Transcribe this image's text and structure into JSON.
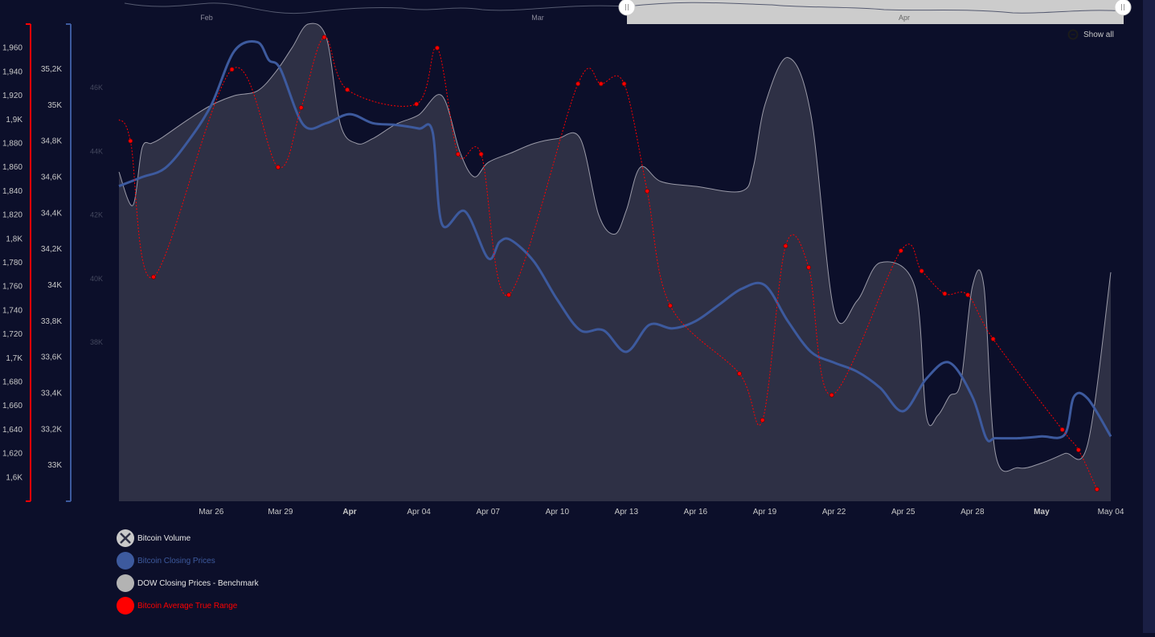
{
  "colors": {
    "background": "#0c0f2a",
    "volume": "#2e3045",
    "volume_line": "#9a9aa8",
    "btc": "#3d5a9e",
    "dow": "#b3b3b3",
    "atr": "#ff0000",
    "axis_text": "#c8c8c8",
    "navigator_fill": "#cccccc"
  },
  "navigator": {
    "labels": [
      "Feb",
      "Mar",
      "Apr"
    ]
  },
  "show_all": {
    "label": "Show all",
    "icon": "zoom-out-icon"
  },
  "chart_data": {
    "type": "line",
    "title": "",
    "x_labels": [
      "Mar 26",
      "Mar 29",
      "Apr",
      "Apr 04",
      "Apr 07",
      "Apr 10",
      "Apr 13",
      "Apr 16",
      "Apr 19",
      "Apr 22",
      "Apr 25",
      "Apr 28",
      "May",
      "May 04"
    ],
    "x_labels_bold": [
      "Apr",
      "May"
    ],
    "xlim": [
      "Mar 22",
      "May 04"
    ],
    "axes": [
      {
        "id": "atr",
        "color": "#ff0000",
        "ylim": [
          1580,
          1980
        ],
        "ticks": [
          "1,6K",
          "1,620",
          "1,640",
          "1,660",
          "1,680",
          "1,7K",
          "1,720",
          "1,740",
          "1,760",
          "1,780",
          "1,8K",
          "1,820",
          "1,840",
          "1,860",
          "1,880",
          "1,9K",
          "1,920",
          "1,940",
          "1,960"
        ],
        "tick_values": [
          1600,
          1620,
          1640,
          1660,
          1680,
          1700,
          1720,
          1740,
          1760,
          1780,
          1800,
          1820,
          1840,
          1860,
          1880,
          1900,
          1920,
          1940,
          1960
        ]
      },
      {
        "id": "btc",
        "color": "#3d5a9e",
        "ylim": [
          32800,
          35450
        ],
        "ticks": [
          "33K",
          "33,2K",
          "33,4K",
          "33,6K",
          "33,8K",
          "34K",
          "34,2K",
          "34,4K",
          "34,6K",
          "34,8K",
          "35K",
          "35,2K"
        ],
        "tick_values": [
          33000,
          33200,
          33400,
          33600,
          33800,
          34000,
          34200,
          34400,
          34600,
          34800,
          35000,
          35200
        ]
      },
      {
        "id": "dow",
        "color": "#44485e",
        "ylim": [
          33000,
          48000
        ],
        "ticks": [
          "38K",
          "40K",
          "42K",
          "44K",
          "46K"
        ],
        "tick_values": [
          38000,
          40000,
          42000,
          44000,
          46000
        ]
      },
      {
        "id": "volume",
        "ylim": [
          0,
          100
        ]
      }
    ],
    "series": [
      {
        "name": "Bitcoin Volume",
        "type": "area",
        "axis": "volume",
        "x": [
          "Mar 22",
          "Mar 22.6",
          "Mar 23",
          "Mar 23.4",
          "Mar 23.8",
          "Mar 25",
          "Mar 26",
          "Mar 27",
          "Mar 28",
          "Mar 28.8",
          "Mar 29.5",
          "Mar 30.2",
          "Mar 31",
          "Mar 31.6",
          "Apr 01.3",
          "Apr 02",
          "Apr 03",
          "Apr 04",
          "Apr 05",
          "Apr 05.8",
          "Apr 06.4",
          "Apr 07",
          "Apr 08",
          "Apr 09",
          "Apr 10",
          "Apr 11",
          "Apr 11.8",
          "Apr 12.5",
          "Apr 13",
          "Apr 13.6",
          "Apr 14.5",
          "Apr 16",
          "Apr 18",
          "Apr 18.5",
          "Apr 19",
          "Apr 20",
          "Apr 21",
          "Apr 22",
          "Apr 23",
          "Apr 24",
          "Apr 25.5",
          "Apr 26",
          "Apr 26.5",
          "Apr 27",
          "Apr 27.5",
          "Apr 28",
          "Apr 28.5",
          "Apr 29",
          "Apr 30",
          "May 01",
          "May 02",
          "May 03",
          "May 04"
        ],
        "y": [
          69,
          62,
          74,
          75,
          76,
          80,
          83,
          85,
          86,
          90,
          95,
          100,
          97,
          79,
          75,
          76,
          79,
          81,
          85,
          73,
          68,
          71,
          73,
          75,
          76,
          76,
          60,
          56,
          61,
          70,
          67,
          66,
          65,
          70,
          83,
          93,
          81,
          40,
          42,
          50,
          45,
          18,
          18,
          22,
          25,
          45,
          45,
          10,
          7,
          8,
          10,
          12,
          48
        ]
      },
      {
        "name": "Bitcoin Closing Prices",
        "type": "spline",
        "axis": "btc",
        "x": [
          "Mar 22",
          "Mar 23",
          "Mar 24",
          "Mar 25",
          "Mar 26",
          "Mar 27",
          "Mar 28",
          "Mar 28.5",
          "Mar 29",
          "Mar 30",
          "Mar 31",
          "Apr 01",
          "Apr 02",
          "Apr 03",
          "Apr 04",
          "Apr 04.6",
          "Apr 05",
          "Apr 06",
          "Apr 07",
          "Apr 07.5",
          "Apr 08",
          "Apr 09",
          "Apr 10",
          "Apr 11",
          "Apr 12",
          "Apr 13",
          "Apr 14",
          "Apr 15",
          "Apr 16",
          "Apr 17",
          "Apr 18",
          "Apr 19",
          "Apr 20",
          "Apr 21",
          "Apr 22",
          "Apr 23",
          "Apr 24",
          "Apr 25",
          "Apr 26",
          "Apr 27",
          "Apr 28",
          "Apr 28.6",
          "Apr 29",
          "Apr 30",
          "May 01",
          "May 02",
          "May 02.4",
          "May 03",
          "May 04"
        ],
        "y": [
          34550,
          34600,
          34650,
          34800,
          35000,
          35300,
          35350,
          35250,
          35200,
          34890,
          34900,
          34950,
          34900,
          34890,
          34870,
          34850,
          34340,
          34410,
          34150,
          34240,
          34250,
          34130,
          33920,
          33750,
          33750,
          33630,
          33780,
          33760,
          33800,
          33890,
          33980,
          34000,
          33800,
          33630,
          33570,
          33520,
          33430,
          33300,
          33480,
          33570,
          33380,
          33150,
          33150,
          33150,
          33160,
          33170,
          33380,
          33370,
          33160
        ]
      },
      {
        "name": "DOW Closing Prices - Benchmark",
        "type": "spline",
        "axis": "volume",
        "hidden": true
      },
      {
        "name": "Bitcoin Average True Range",
        "type": "spline",
        "axis": "atr",
        "dashed": true,
        "x": [
          "Mar 22",
          "Mar 22.5",
          "Mar 23.5",
          "Mar 26.9",
          "Mar 28.9",
          "Mar 29.9",
          "Mar 30.9",
          "Mar 31.9",
          "Apr 03.9",
          "Apr 04.8",
          "Apr 05.7",
          "Apr 06.7",
          "Apr 07.9",
          "Apr 10.9",
          "Apr 11.9",
          "Apr 12.9",
          "Apr 13.9",
          "Apr 14.9",
          "Apr 17.9",
          "Apr 18.9",
          "Apr 19.9",
          "Apr 20.9",
          "Apr 21.9",
          "Apr 24.9",
          "Apr 25.8",
          "Apr 26.8",
          "Apr 27.8",
          "Apr 28.9",
          "Apr 31.9",
          "May 02.6",
          "May 03.4"
        ],
        "y": [
          1900,
          1882,
          1768,
          1942,
          1860,
          1910,
          1969,
          1925,
          1913,
          1960,
          1871,
          1871,
          1753,
          1930,
          1930,
          1930,
          1840,
          1744,
          1687,
          1648,
          1794,
          1776,
          1669,
          1790,
          1773,
          1754,
          1753,
          1716,
          1640,
          1623,
          1590
        ]
      }
    ],
    "legend": [
      "Bitcoin Volume",
      "Bitcoin Closing Prices",
      "DOW Closing Prices - Benchmark",
      "Bitcoin Average True Range"
    ],
    "legend_placement": "bottom-left",
    "grid": false
  }
}
